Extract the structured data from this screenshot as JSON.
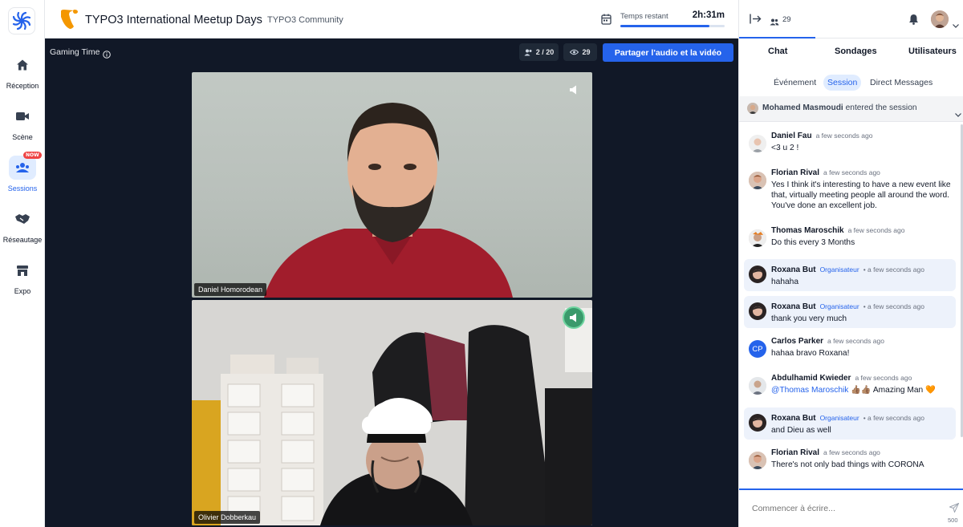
{
  "nav": {
    "items": [
      {
        "label": "Réception",
        "icon": "home-icon"
      },
      {
        "label": "Scène",
        "icon": "video-camera-icon"
      },
      {
        "label": "Sessions",
        "icon": "sessions-icon",
        "badge": "NOW"
      },
      {
        "label": "Réseautage",
        "icon": "handshake-icon"
      },
      {
        "label": "Expo",
        "icon": "store-icon"
      }
    ]
  },
  "header": {
    "title": "TYPO3 International Meetup Days",
    "community": "TYPO3 Community",
    "time_label": "Temps restant",
    "time_value": "2h:31m",
    "time_progress": 0.85
  },
  "session": {
    "name": "Gaming Time",
    "participants": "2 / 20",
    "viewers": "29",
    "share_button": "Partager l'audio et la vidéo",
    "videos": [
      {
        "name": "Daniel Homorodean"
      },
      {
        "name": "Olivier Dobberkau"
      }
    ]
  },
  "panel": {
    "attendee_count": "29",
    "tabs": [
      "Chat",
      "Sondages",
      "Utilisateurs"
    ],
    "subtabs": [
      "Événement",
      "Session",
      "Direct Messages"
    ],
    "banner_name": "Mohamed Masmoudi",
    "banner_text": "entered the session",
    "messages": [
      {
        "name": "Daniel Fau",
        "time": "a few seconds ago",
        "text": "<3 u 2 !"
      },
      {
        "name": "Florian Rival",
        "time": "a few seconds ago",
        "text": "Yes I think it's interesting to have a new event like that, virtually meeting people all around the word. You've done an excellent job."
      },
      {
        "name": "Thomas Maroschik",
        "time": "a few seconds ago",
        "text": "Do this every 3 Months"
      },
      {
        "name": "Roxana But",
        "role": "Organisateur",
        "time": "• a few seconds ago",
        "text": "hahaha"
      },
      {
        "name": "Roxana But",
        "role": "Organisateur",
        "time": "• a few seconds ago",
        "text": "thank you very much"
      },
      {
        "name": "Carlos Parker",
        "initials": "CP",
        "time": "a few seconds ago",
        "text": "hahaa bravo Roxana!"
      },
      {
        "name": "Abdulhamid Kwieder",
        "time": "a few seconds ago",
        "mention": "@Thomas Maroschik",
        "text": "👍🏽👍🏽 Amazing Man 🧡"
      },
      {
        "name": "Roxana But",
        "role": "Organisateur",
        "time": "• a few seconds ago",
        "text": "and Dieu as well"
      },
      {
        "name": "Florian Rival",
        "time": "a few seconds ago",
        "text": "There's not only bad things with CORONA"
      }
    ],
    "input_placeholder": "Commencer à écrire...",
    "char_limit": "500"
  }
}
